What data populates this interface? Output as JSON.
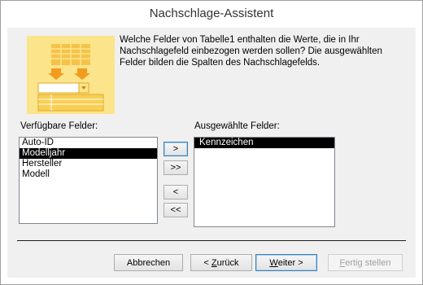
{
  "window": {
    "title": "Nachschlage-Assistent"
  },
  "instructions": "Welche Felder von Tabelle1 enthalten die Werte, die in Ihr Nachschlagefeld einbezogen werden sollen? Die ausgewählten Felder bilden die Spalten des Nachschlagefelds.",
  "available": {
    "label": "Verfügbare Felder:",
    "items": [
      "Auto-ID",
      "Modelljahr",
      "Hersteller",
      "Modell"
    ],
    "selected_index": 1
  },
  "selected": {
    "label": "Ausgewählte Felder:",
    "items": [
      "Kennzeichen"
    ],
    "selected_index": 0
  },
  "move_buttons": {
    "add_one": ">",
    "add_all": ">>",
    "remove_one": "<",
    "remove_all": "<<"
  },
  "footer": {
    "cancel": "Abbrechen",
    "back_prefix": "< ",
    "back_mnemonic": "Z",
    "back_rest": "urück",
    "next_mnemonic": "W",
    "next_rest": "eiter >",
    "finish_mnemonic": "F",
    "finish_rest": "ertig stellen"
  },
  "colors": {
    "accent_yellow": "#f8d564",
    "accent_orange": "#f5a623",
    "selection": "#000000",
    "focus_border": "#3c7fb1"
  }
}
